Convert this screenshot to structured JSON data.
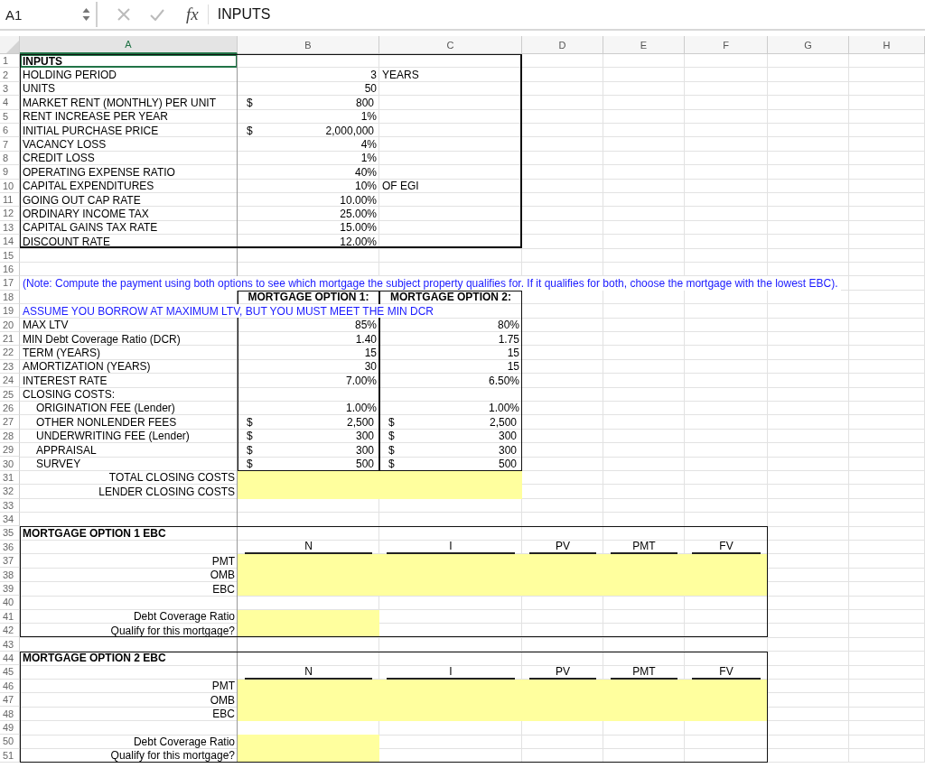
{
  "name_box": "A1",
  "fx_label": "fx",
  "formula": "INPUTS",
  "columns": [
    {
      "label": "A",
      "selected": true
    },
    {
      "label": "B",
      "selected": false
    },
    {
      "label": "C",
      "selected": false
    },
    {
      "label": "D",
      "selected": false
    },
    {
      "label": "E",
      "selected": false
    },
    {
      "label": "F",
      "selected": false
    },
    {
      "label": "G",
      "selected": false
    },
    {
      "label": "H",
      "selected": false
    }
  ],
  "rows": [
    {
      "number": "1",
      "a": {
        "kind": "heading",
        "text": "INPUTS",
        "selected": true
      }
    },
    {
      "number": "2",
      "a": {
        "kind": "label",
        "text": "HOLDING PERIOD"
      },
      "b": {
        "kind": "number",
        "text": "3"
      },
      "c": {
        "kind": "label",
        "text": "YEARS"
      }
    },
    {
      "number": "3",
      "a": {
        "kind": "label",
        "text": "UNITS"
      },
      "b": {
        "kind": "number",
        "text": "50"
      }
    },
    {
      "number": "4",
      "a": {
        "kind": "label",
        "text": "MARKET RENT (MONTHLY) PER UNIT"
      },
      "b": {
        "kind": "number",
        "currency": "$",
        "text": "800"
      }
    },
    {
      "number": "5",
      "a": {
        "kind": "label",
        "text": "RENT INCREASE PER YEAR"
      },
      "b": {
        "kind": "number",
        "text": "1%"
      }
    },
    {
      "number": "6",
      "a": {
        "kind": "label",
        "text": "INITIAL PURCHASE PRICE"
      },
      "b": {
        "kind": "number",
        "currency": "$",
        "text": "2,000,000"
      }
    },
    {
      "number": "7",
      "a": {
        "kind": "label",
        "text": "VACANCY LOSS"
      },
      "b": {
        "kind": "number",
        "text": "4%"
      }
    },
    {
      "number": "8",
      "a": {
        "kind": "label",
        "text": "CREDIT LOSS"
      },
      "b": {
        "kind": "number",
        "text": "1%"
      }
    },
    {
      "number": "9",
      "a": {
        "kind": "label",
        "text": "OPERATING EXPENSE RATIO"
      },
      "b": {
        "kind": "number",
        "text": "40%"
      }
    },
    {
      "number": "10",
      "a": {
        "kind": "label",
        "text": "CAPITAL EXPENDITURES"
      },
      "b": {
        "kind": "number",
        "text": "10%"
      },
      "c": {
        "kind": "label",
        "text": "OF EGI"
      }
    },
    {
      "number": "11",
      "a": {
        "kind": "label",
        "text": "GOING OUT CAP RATE"
      },
      "b": {
        "kind": "number",
        "text": "10.00%"
      }
    },
    {
      "number": "12",
      "a": {
        "kind": "label",
        "text": "ORDINARY INCOME TAX"
      },
      "b": {
        "kind": "number",
        "text": "25.00%"
      }
    },
    {
      "number": "13",
      "a": {
        "kind": "label",
        "text": "CAPITAL GAINS TAX RATE"
      },
      "b": {
        "kind": "number",
        "text": "15.00%"
      }
    },
    {
      "number": "14",
      "a": {
        "kind": "label",
        "text": "DISCOUNT RATE"
      },
      "b": {
        "kind": "number",
        "text": "12.00%"
      }
    },
    {
      "number": "15"
    },
    {
      "number": "16"
    },
    {
      "number": "17",
      "a": {
        "kind": "note",
        "text": "(Note: Compute the payment using both options to see which mortgage the subject property qualifies for. If it qualifies for both, choose the mortgage with the lowest EBC)."
      }
    },
    {
      "number": "18",
      "b": {
        "kind": "title",
        "text": "MORTGAGE OPTION 1:"
      },
      "c": {
        "kind": "title",
        "text": "MORTGAGE OPTION 2:"
      }
    },
    {
      "number": "19",
      "a": {
        "kind": "note",
        "text": "ASSUME YOU BORROW AT MAXIMUM LTV, BUT YOU MUST MEET THE MIN DCR"
      }
    },
    {
      "number": "20",
      "a": {
        "kind": "label",
        "text": "MAX LTV"
      },
      "b": {
        "kind": "number",
        "text": "85%"
      },
      "c": {
        "kind": "number",
        "text": "80%"
      }
    },
    {
      "number": "21",
      "a": {
        "kind": "label",
        "text": "MIN Debt Coverage Ratio (DCR)"
      },
      "b": {
        "kind": "number",
        "text": "1.40"
      },
      "c": {
        "kind": "number",
        "text": "1.75"
      }
    },
    {
      "number": "22",
      "a": {
        "kind": "label",
        "text": "TERM (YEARS)"
      },
      "b": {
        "kind": "number",
        "text": "15"
      },
      "c": {
        "kind": "number",
        "text": "15"
      }
    },
    {
      "number": "23",
      "a": {
        "kind": "label",
        "text": "AMORTIZATION (YEARS)"
      },
      "b": {
        "kind": "number",
        "text": "30"
      },
      "c": {
        "kind": "number",
        "text": "15"
      }
    },
    {
      "number": "24",
      "a": {
        "kind": "label",
        "text": "INTEREST RATE"
      },
      "b": {
        "kind": "number",
        "text": "7.00%"
      },
      "c": {
        "kind": "number",
        "text": "6.50%"
      }
    },
    {
      "number": "25",
      "a": {
        "kind": "label",
        "text": "CLOSING COSTS:"
      }
    },
    {
      "number": "26",
      "a": {
        "kind": "indent",
        "text": "ORIGINATION FEE (Lender)"
      },
      "b": {
        "kind": "number",
        "text": "1.00%"
      },
      "c": {
        "kind": "number",
        "text": "1.00%"
      }
    },
    {
      "number": "27",
      "a": {
        "kind": "indent",
        "text": "OTHER NONLENDER FEES"
      },
      "b": {
        "kind": "number",
        "currency": "$",
        "text": "2,500"
      },
      "c": {
        "kind": "number",
        "currency": "$",
        "text": "2,500"
      }
    },
    {
      "number": "28",
      "a": {
        "kind": "indent",
        "text": "UNDERWRITING FEE (Lender)"
      },
      "b": {
        "kind": "number",
        "currency": "$",
        "text": "300"
      },
      "c": {
        "kind": "number",
        "currency": "$",
        "text": "300"
      }
    },
    {
      "number": "29",
      "a": {
        "kind": "indent",
        "text": "APPRAISAL"
      },
      "b": {
        "kind": "number",
        "currency": "$",
        "text": "300"
      },
      "c": {
        "kind": "number",
        "currency": "$",
        "text": "300"
      }
    },
    {
      "number": "30",
      "a": {
        "kind": "indent",
        "text": "SURVEY"
      },
      "b": {
        "kind": "number",
        "currency": "$",
        "text": "500"
      },
      "c": {
        "kind": "number",
        "currency": "$",
        "text": "500"
      }
    },
    {
      "number": "31",
      "a": {
        "kind": "label_right",
        "text": "TOTAL CLOSING COSTS"
      },
      "b": {
        "kind": "input"
      },
      "c": {
        "kind": "input"
      }
    },
    {
      "number": "32",
      "a": {
        "kind": "label_right",
        "text": "LENDER CLOSING COSTS"
      },
      "b": {
        "kind": "input"
      },
      "c": {
        "kind": "input"
      }
    },
    {
      "number": "33"
    },
    {
      "number": "34"
    },
    {
      "number": "35",
      "a": {
        "kind": "heading",
        "text": "MORTGAGE OPTION 1 EBC"
      }
    },
    {
      "number": "36",
      "b": {
        "kind": "column_head",
        "text": "N"
      },
      "c": {
        "kind": "column_head",
        "text": "I"
      },
      "d": {
        "kind": "column_head",
        "text": "PV"
      },
      "e": {
        "kind": "column_head",
        "text": "PMT"
      },
      "f": {
        "kind": "column_head",
        "text": "FV"
      }
    },
    {
      "number": "37",
      "a": {
        "kind": "label_right",
        "text": "PMT"
      },
      "b": {
        "kind": "input"
      },
      "c": {
        "kind": "input"
      },
      "d": {
        "kind": "input"
      },
      "e": {
        "kind": "input"
      },
      "f": {
        "kind": "input"
      }
    },
    {
      "number": "38",
      "a": {
        "kind": "label_right",
        "text": "OMB"
      },
      "b": {
        "kind": "input"
      },
      "c": {
        "kind": "input"
      },
      "d": {
        "kind": "input"
      },
      "e": {
        "kind": "input"
      },
      "f": {
        "kind": "input"
      }
    },
    {
      "number": "39",
      "a": {
        "kind": "label_right",
        "text": "EBC"
      },
      "b": {
        "kind": "input"
      },
      "c": {
        "kind": "input"
      },
      "d": {
        "kind": "input"
      },
      "e": {
        "kind": "input"
      },
      "f": {
        "kind": "input"
      }
    },
    {
      "number": "40"
    },
    {
      "number": "41",
      "a": {
        "kind": "label_right",
        "text": "Debt Coverage Ratio"
      },
      "b": {
        "kind": "input"
      }
    },
    {
      "number": "42",
      "a": {
        "kind": "label_right",
        "text": "Qualify for this mortgage?"
      },
      "b": {
        "kind": "input"
      }
    },
    {
      "number": "43"
    },
    {
      "number": "44",
      "a": {
        "kind": "heading",
        "text": "MORTGAGE OPTION 2 EBC"
      }
    },
    {
      "number": "45",
      "b": {
        "kind": "column_head",
        "text": "N"
      },
      "c": {
        "kind": "column_head",
        "text": "I"
      },
      "d": {
        "kind": "column_head",
        "text": "PV"
      },
      "e": {
        "kind": "column_head",
        "text": "PMT"
      },
      "f": {
        "kind": "column_head",
        "text": "FV"
      }
    },
    {
      "number": "46",
      "a": {
        "kind": "label_right",
        "text": "PMT"
      },
      "b": {
        "kind": "input"
      },
      "c": {
        "kind": "input"
      },
      "d": {
        "kind": "input"
      },
      "e": {
        "kind": "input"
      },
      "f": {
        "kind": "input"
      }
    },
    {
      "number": "47",
      "a": {
        "kind": "label_right",
        "text": "OMB"
      },
      "b": {
        "kind": "input"
      },
      "c": {
        "kind": "input"
      },
      "d": {
        "kind": "input"
      },
      "e": {
        "kind": "input"
      },
      "f": {
        "kind": "input"
      }
    },
    {
      "number": "48",
      "a": {
        "kind": "label_right",
        "text": "EBC"
      },
      "b": {
        "kind": "input"
      },
      "c": {
        "kind": "input"
      },
      "d": {
        "kind": "input"
      },
      "e": {
        "kind": "input"
      },
      "f": {
        "kind": "input"
      }
    },
    {
      "number": "49"
    },
    {
      "number": "50",
      "a": {
        "kind": "label_right",
        "text": "Debt Coverage Ratio"
      },
      "b": {
        "kind": "input"
      }
    },
    {
      "number": "51",
      "a": {
        "kind": "label_right",
        "text": "Qualify for this mortgage?"
      },
      "b": {
        "kind": "input"
      }
    }
  ]
}
